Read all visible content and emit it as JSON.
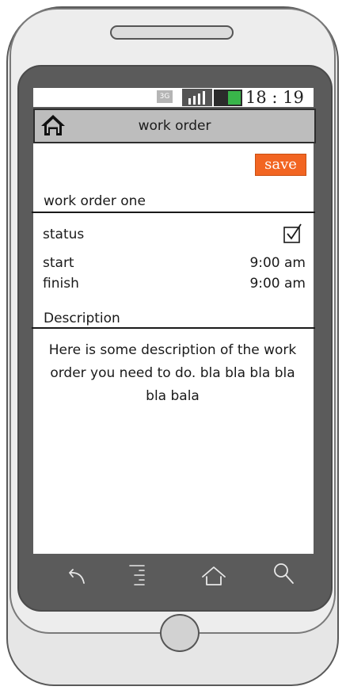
{
  "status_bar": {
    "network_label": "3G",
    "time": "18 : 19",
    "battery_color": "#39b54a"
  },
  "header": {
    "title": "work order",
    "home_icon": "home-icon"
  },
  "toolbar": {
    "save_label": "save",
    "save_color": "#f26522"
  },
  "order": {
    "name": "work order one",
    "status_label": "status",
    "status_checked": true,
    "start_label": "start",
    "start_value": "9:00 am",
    "finish_label": "finish",
    "finish_value": "9:00 am"
  },
  "description": {
    "header": "Description",
    "text": "Here is some description of the work order you need to do. bla bla bla bla bla bala"
  },
  "navbar": {
    "icons": [
      "back-icon",
      "menu-icon",
      "home-icon",
      "search-icon"
    ]
  }
}
